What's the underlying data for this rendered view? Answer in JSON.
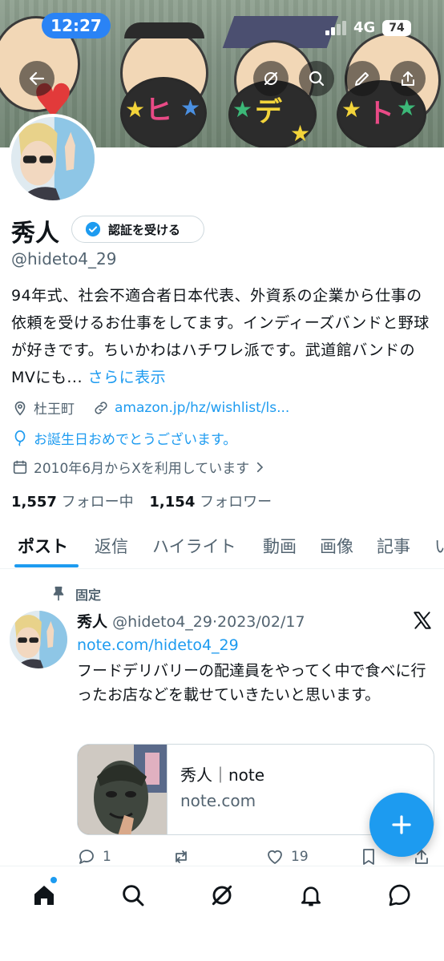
{
  "status_bar": {
    "time": "12:27",
    "network": "4G",
    "battery": "74"
  },
  "banner": {
    "mask_texts": [
      "ヒ",
      "デ",
      "ト"
    ]
  },
  "profile": {
    "name": "秀人",
    "verify_label": "認証を受ける",
    "handle": "@hideto4_29",
    "bio": "94年式、社会不適合者日本代表、外資系の企業から仕事の依頼を受けるお仕事をしてます。インディーズバンドと野球が好きです。ちいかわはハチワレ派です。武道館バンドのMVにも...",
    "bio_more": "さらに表示",
    "location": "杜王町",
    "link": "amazon.jp/hz/wishlist/ls...",
    "birthday": "お誕生日おめでとうございます。",
    "joined": "2010年6月からXを利用しています",
    "following_count": "1,557",
    "following_label": "フォロー中",
    "followers_count": "1,154",
    "followers_label": "フォロワー"
  },
  "tabs": [
    "ポスト",
    "返信",
    "ハイライト",
    "動画",
    "画像",
    "記事",
    "い"
  ],
  "post": {
    "pinned_label": "固定",
    "name": "秀人",
    "handle": "@hideto4_29",
    "date": "2023/02/17",
    "link": "note.com/hideto4_29",
    "text": "フードデリバリーの配達員をやってく中で食べに行ったお店などを載せていきたいと思います。",
    "card_title": "秀人｜note",
    "card_domain": "note.com",
    "reply_count": "1",
    "like_count": "19"
  },
  "colors": {
    "accent": "#1d9bf0",
    "text": "#0f1419",
    "secondary": "#536471",
    "time_pill": "#2a83f5"
  },
  "icons": [
    "back-arrow-icon",
    "grok-icon",
    "search-icon",
    "edit-pencil-icon",
    "share-icon",
    "verified-badge-icon",
    "location-pin-icon",
    "link-icon",
    "balloon-icon",
    "calendar-icon",
    "chevron-right-icon",
    "pin-icon",
    "x-logo-icon",
    "reply-icon",
    "repost-icon",
    "like-icon",
    "bookmark-icon",
    "plus-icon",
    "home-icon",
    "notifications-icon",
    "messages-icon"
  ]
}
